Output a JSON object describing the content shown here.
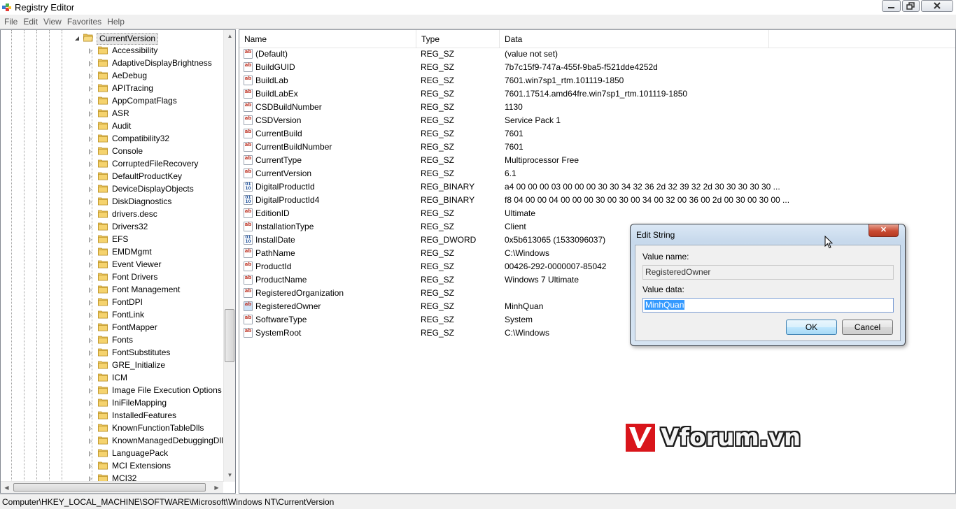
{
  "window": {
    "title": "Registry Editor",
    "icon": "registry-editor-icon",
    "controls": {
      "minimize": "—",
      "maximize": "□",
      "close": "✕"
    }
  },
  "menu": [
    "File",
    "Edit",
    "View",
    "Favorites",
    "Help"
  ],
  "tree": {
    "current": "CurrentVersion",
    "items": [
      "Accessibility",
      "AdaptiveDisplayBrightness",
      "AeDebug",
      "APITracing",
      "AppCompatFlags",
      "ASR",
      "Audit",
      "Compatibility32",
      "Console",
      "CorruptedFileRecovery",
      "DefaultProductKey",
      "DeviceDisplayObjects",
      "DiskDiagnostics",
      "drivers.desc",
      "Drivers32",
      "EFS",
      "EMDMgmt",
      "Event Viewer",
      "Font Drivers",
      "Font Management",
      "FontDPI",
      "FontLink",
      "FontMapper",
      "Fonts",
      "FontSubstitutes",
      "GRE_Initialize",
      "ICM",
      "Image File Execution Options",
      "IniFileMapping",
      "InstalledFeatures",
      "KnownFunctionTableDlls",
      "KnownManagedDebuggingDll",
      "LanguagePack",
      "MCI Extensions",
      "MCI32"
    ]
  },
  "values": {
    "columns": {
      "name": "Name",
      "type": "Type",
      "data": "Data"
    },
    "rows": [
      {
        "name": "(Default)",
        "type": "REG_SZ",
        "data": "(value not set)",
        "icon": "sz"
      },
      {
        "name": "BuildGUID",
        "type": "REG_SZ",
        "data": "7b7c15f9-747a-455f-9ba5-f521dde4252d",
        "icon": "sz"
      },
      {
        "name": "BuildLab",
        "type": "REG_SZ",
        "data": "7601.win7sp1_rtm.101119-1850",
        "icon": "sz"
      },
      {
        "name": "BuildLabEx",
        "type": "REG_SZ",
        "data": "7601.17514.amd64fre.win7sp1_rtm.101119-1850",
        "icon": "sz"
      },
      {
        "name": "CSDBuildNumber",
        "type": "REG_SZ",
        "data": "1130",
        "icon": "sz"
      },
      {
        "name": "CSDVersion",
        "type": "REG_SZ",
        "data": "Service Pack 1",
        "icon": "sz"
      },
      {
        "name": "CurrentBuild",
        "type": "REG_SZ",
        "data": "7601",
        "icon": "sz"
      },
      {
        "name": "CurrentBuildNumber",
        "type": "REG_SZ",
        "data": "7601",
        "icon": "sz"
      },
      {
        "name": "CurrentType",
        "type": "REG_SZ",
        "data": "Multiprocessor Free",
        "icon": "sz"
      },
      {
        "name": "CurrentVersion",
        "type": "REG_SZ",
        "data": "6.1",
        "icon": "sz"
      },
      {
        "name": "DigitalProductId",
        "type": "REG_BINARY",
        "data": "a4 00 00 00 03 00 00 00 30 30 34 32 36 2d 32 39 32 2d 30 30 30 30 30 ...",
        "icon": "bin"
      },
      {
        "name": "DigitalProductId4",
        "type": "REG_BINARY",
        "data": "f8 04 00 00 04 00 00 00 30 00 30 00 34 00 32 00 36 00 2d 00 30 00 30 00 ...",
        "icon": "bin"
      },
      {
        "name": "EditionID",
        "type": "REG_SZ",
        "data": "Ultimate",
        "icon": "sz"
      },
      {
        "name": "InstallationType",
        "type": "REG_SZ",
        "data": "Client",
        "icon": "sz"
      },
      {
        "name": "InstallDate",
        "type": "REG_DWORD",
        "data": "0x5b613065 (1533096037)",
        "icon": "bin"
      },
      {
        "name": "PathName",
        "type": "REG_SZ",
        "data": "C:\\Windows",
        "icon": "sz"
      },
      {
        "name": "ProductId",
        "type": "REG_SZ",
        "data": "00426-292-0000007-85042",
        "icon": "sz"
      },
      {
        "name": "ProductName",
        "type": "REG_SZ",
        "data": "Windows 7 Ultimate",
        "icon": "sz"
      },
      {
        "name": "RegisteredOrganization",
        "type": "REG_SZ",
        "data": "",
        "icon": "sz"
      },
      {
        "name": "RegisteredOwner",
        "type": "REG_SZ",
        "data": "MinhQuan",
        "icon": "sz",
        "selected": true
      },
      {
        "name": "SoftwareType",
        "type": "REG_SZ",
        "data": "System",
        "icon": "sz"
      },
      {
        "name": "SystemRoot",
        "type": "REG_SZ",
        "data": "C:\\Windows",
        "icon": "sz"
      }
    ]
  },
  "statusbar": {
    "path": "Computer\\HKEY_LOCAL_MACHINE\\SOFTWARE\\Microsoft\\Windows NT\\CurrentVersion"
  },
  "dialog": {
    "title": "Edit String",
    "close_glyph": "✕",
    "value_name_label": "Value name:",
    "value_name": "RegisteredOwner",
    "value_data_label": "Value data:",
    "value_data": "MinhQuan",
    "ok_label": "OK",
    "cancel_label": "Cancel"
  },
  "watermark": {
    "text": "Vforum.vn"
  },
  "colors": {
    "selection": "#3399ff",
    "close_button": "#c94b33",
    "watermark_red": "#d9151b"
  }
}
